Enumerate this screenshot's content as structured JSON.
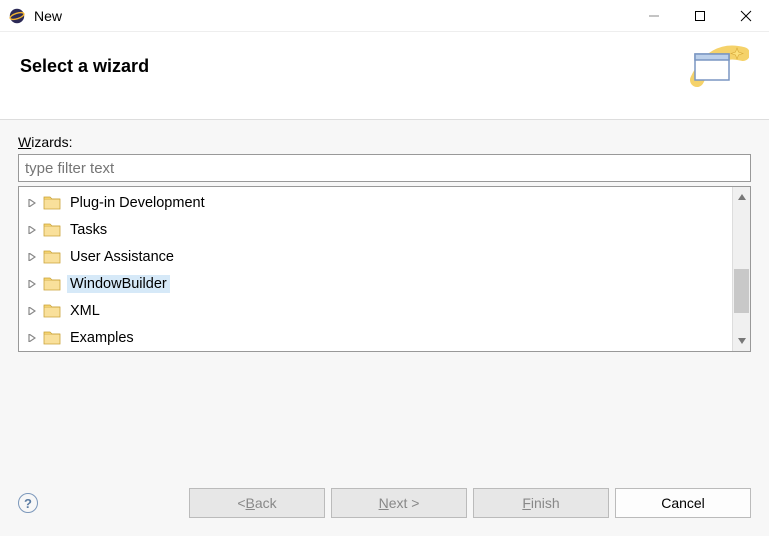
{
  "titlebar": {
    "title": "New"
  },
  "header": {
    "title": "Select a wizard"
  },
  "wizards_label_prefix": "W",
  "wizards_label_rest": "izards:",
  "filter_placeholder": "type filter text",
  "tree": {
    "items": [
      {
        "label": "Plug-in Development",
        "selected": false
      },
      {
        "label": "Tasks",
        "selected": false
      },
      {
        "label": "User Assistance",
        "selected": false
      },
      {
        "label": "WindowBuilder",
        "selected": true
      },
      {
        "label": "XML",
        "selected": false
      },
      {
        "label": "Examples",
        "selected": false
      }
    ]
  },
  "buttons": {
    "back_prefix": "< ",
    "back_u": "B",
    "back_rest": "ack",
    "next_u": "N",
    "next_rest": "ext >",
    "finish_u": "F",
    "finish_rest": "inish",
    "cancel": "Cancel"
  }
}
